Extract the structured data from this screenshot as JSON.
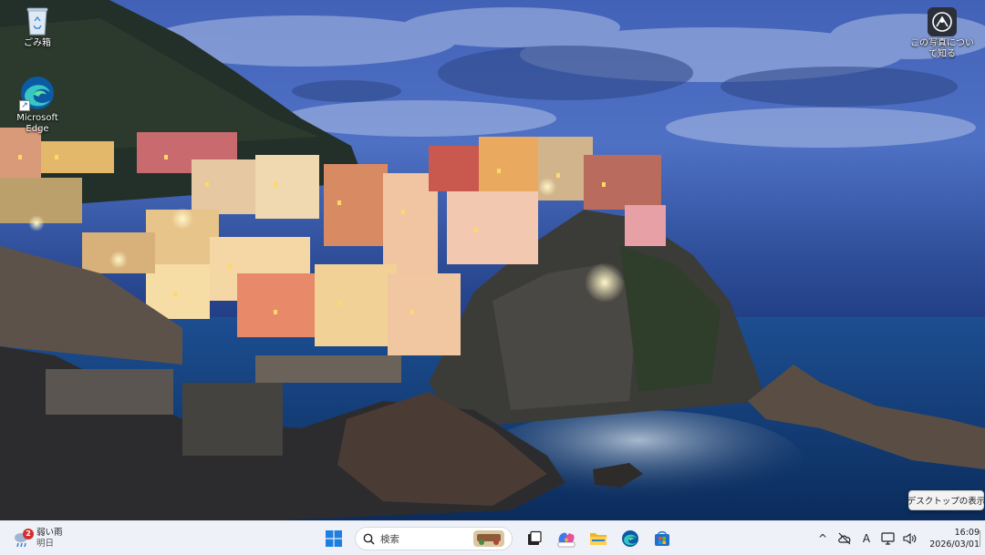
{
  "desktop": {
    "icons": [
      {
        "label": "ごみ箱",
        "icon": "recycle-bin-icon"
      },
      {
        "label": "Microsoft Edge",
        "icon": "edge-icon"
      },
      {
        "label": "この写真について知る",
        "icon": "spotlight-camera-icon"
      }
    ]
  },
  "tooltip": {
    "text": "デスクトップの表示"
  },
  "taskbar": {
    "weather": {
      "condition": "弱い雨",
      "day": "明日",
      "badge": "2",
      "icon": "rain-cloud-icon"
    },
    "start": {
      "icon": "windows-start-icon"
    },
    "search": {
      "placeholder": "検索",
      "icon": "search-icon"
    },
    "apps": [
      {
        "name": "task-view",
        "icon": "task-view-icon"
      },
      {
        "name": "copilot",
        "icon": "copilot-icon"
      },
      {
        "name": "file-explorer",
        "icon": "folder-icon"
      },
      {
        "name": "edge",
        "icon": "edge-icon"
      },
      {
        "name": "store",
        "icon": "store-icon"
      }
    ],
    "tray": {
      "chevron": "^",
      "ime": "A",
      "time": "16:09",
      "date": "2026/03/01"
    }
  },
  "colors": {
    "taskbar_bg": "#eef1f7",
    "sky_top": "#3a5aa8",
    "sea": "#0f3f78"
  }
}
